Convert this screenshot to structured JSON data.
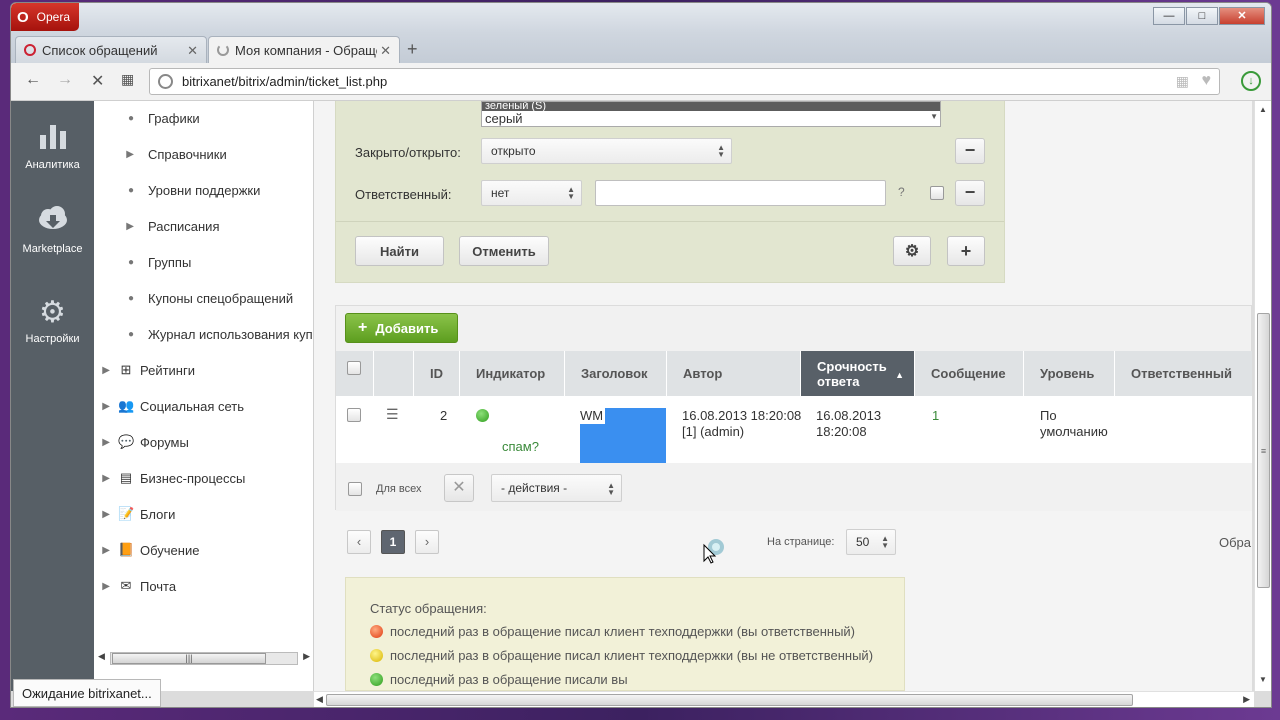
{
  "browser": {
    "app_name": "Opera",
    "tabs": [
      {
        "label": "Список обращений"
      },
      {
        "label": "Моя компания - Обраще"
      }
    ],
    "url": "bitrixanet/bitrix/admin/ticket_list.php",
    "status_text": "Ожидание bitrixanet..."
  },
  "left_panel": {
    "items": [
      {
        "label": "Аналитика",
        "icon": "bar-chart-icon"
      },
      {
        "label": "Marketplace",
        "icon": "cloud-download-icon"
      },
      {
        "label": "Настройки",
        "icon": "gear-icon"
      }
    ]
  },
  "menu": {
    "items": [
      {
        "label": "Графики"
      },
      {
        "label": "Справочники"
      },
      {
        "label": "Уровни поддержки"
      },
      {
        "label": "Расписания"
      },
      {
        "label": "Группы"
      },
      {
        "label": "Купоны спецобращений"
      },
      {
        "label": "Журнал использования куп"
      },
      {
        "label": "Рейтинги"
      },
      {
        "label": "Социальная сеть"
      },
      {
        "label": "Форумы"
      },
      {
        "label": "Бизнес-процессы"
      },
      {
        "label": "Блоги"
      },
      {
        "label": "Обучение"
      },
      {
        "label": "Почта"
      }
    ]
  },
  "filter": {
    "list_option_selected": "зеленый (S)",
    "list_option_2": "серый",
    "closed_label": "Закрыто/открыто:",
    "closed_value": "открыто",
    "responsible_label": "Ответственный:",
    "responsible_value": "нет",
    "help": "?",
    "find_button": "Найти",
    "cancel_button": "Отменить"
  },
  "grid": {
    "add_button": "Добавить",
    "columns": [
      "ID",
      "Индикатор",
      "Заголовок",
      "Автор",
      "Срочность ответа",
      "Сообщение",
      "Уровень",
      "Ответственный"
    ],
    "row": {
      "id": "2",
      "spam": "спам?",
      "title": "WM",
      "author": "16.08.2013 18:20:08 [1] (admin)",
      "urgency": "16.08.2013 18:20:08",
      "messages": "1",
      "level": "По умолчанию"
    },
    "for_all": "Для всех",
    "actions": "- действия -"
  },
  "pager": {
    "current": "1",
    "per_page_label": "На странице:",
    "per_page_value": "50",
    "total_label": "Обра"
  },
  "legend": {
    "title": "Статус обращения:",
    "items": [
      {
        "text": "последний раз в обращение писал клиент техподдержки (вы ответственный)",
        "color": "red"
      },
      {
        "text": "последний раз в обращение писал клиент техподдержки (вы не ответственный)",
        "color": "yellow"
      },
      {
        "text": "последний раз в обращение писали вы",
        "color": "green"
      }
    ]
  }
}
